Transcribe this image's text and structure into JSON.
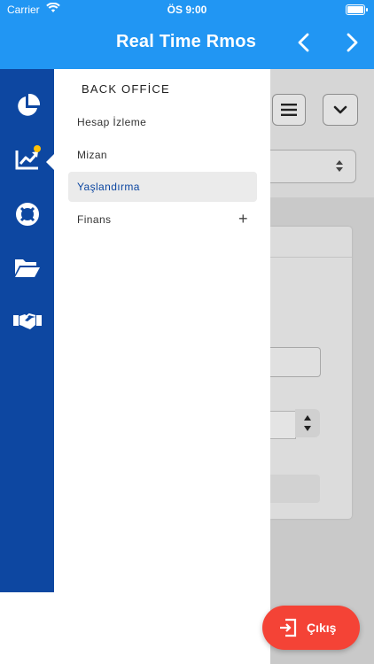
{
  "status_bar": {
    "carrier": "Carrier",
    "time": "ÖS 9:00"
  },
  "header": {
    "title": "Real Time Rmos",
    "prev_icon": "chevron-left-icon",
    "next_icon": "chevron-right-icon"
  },
  "rail": {
    "items": [
      {
        "icon": "pie-chart-icon"
      },
      {
        "icon": "trending-up-icon",
        "active": true,
        "badge": true
      },
      {
        "icon": "lifebuoy-icon"
      },
      {
        "icon": "folder-open-icon"
      },
      {
        "icon": "handshake-icon"
      }
    ]
  },
  "drawer": {
    "title": "BACK OFFİCE",
    "items": [
      {
        "label": "Hesap İzleme"
      },
      {
        "label": "Mizan"
      },
      {
        "label": "Yaşlandırma",
        "active": true
      },
      {
        "label": "Finans",
        "expandable": true
      }
    ]
  },
  "exit_button": {
    "label": "Çıkış",
    "icon": "exit-icon"
  },
  "colors": {
    "header": "#2196f3",
    "rail": "#0d47a1",
    "exit": "#f44336",
    "badge": "#ffc107"
  }
}
